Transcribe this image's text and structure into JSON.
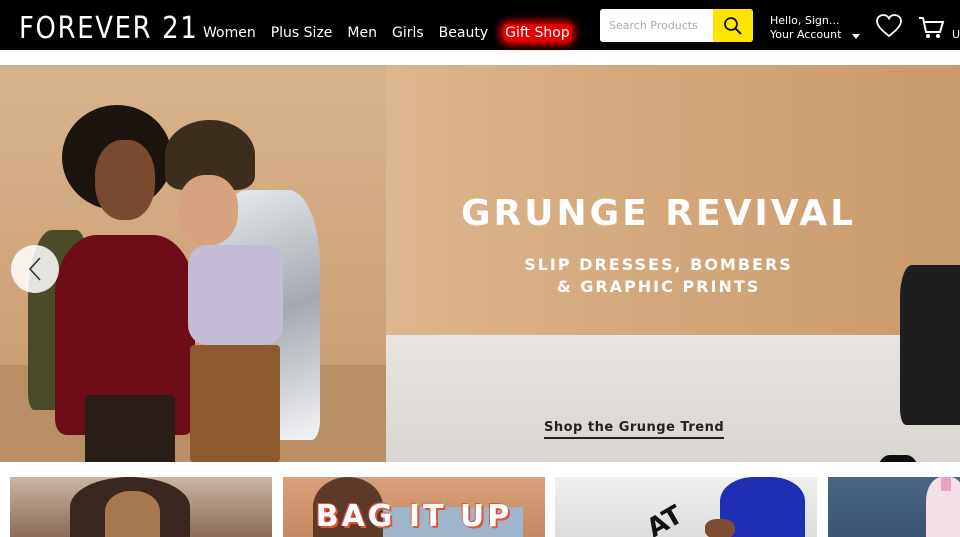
{
  "brand": {
    "logo_text": "FOREVER 21"
  },
  "nav": {
    "items": [
      {
        "label": "Women"
      },
      {
        "label": "Plus Size"
      },
      {
        "label": "Men"
      },
      {
        "label": "Girls"
      },
      {
        "label": "Beauty"
      },
      {
        "label": "Gift Shop"
      }
    ],
    "gift_shop_color": "#e40000"
  },
  "search": {
    "placeholder": "Search Products",
    "button_color": "#ffe400",
    "icon": "search-icon"
  },
  "account": {
    "greeting": "Hello, Sign...",
    "label": "Your Account"
  },
  "icons": {
    "wishlist": "heart-icon",
    "cart": "cart-icon",
    "prev": "chevron-left-icon"
  },
  "cart": {
    "label": "U"
  },
  "hero": {
    "title": "GRUNGE REVIVAL",
    "subtitle_line1": "SLIP DRESSES, BOMBERS",
    "subtitle_line2": "& GRAPHIC PRINTS",
    "cta": "Shop the Grunge Trend"
  },
  "tiles": [
    {
      "title": ""
    },
    {
      "title": "BAG IT UP"
    },
    {
      "title": "AT"
    },
    {
      "title": ""
    }
  ]
}
